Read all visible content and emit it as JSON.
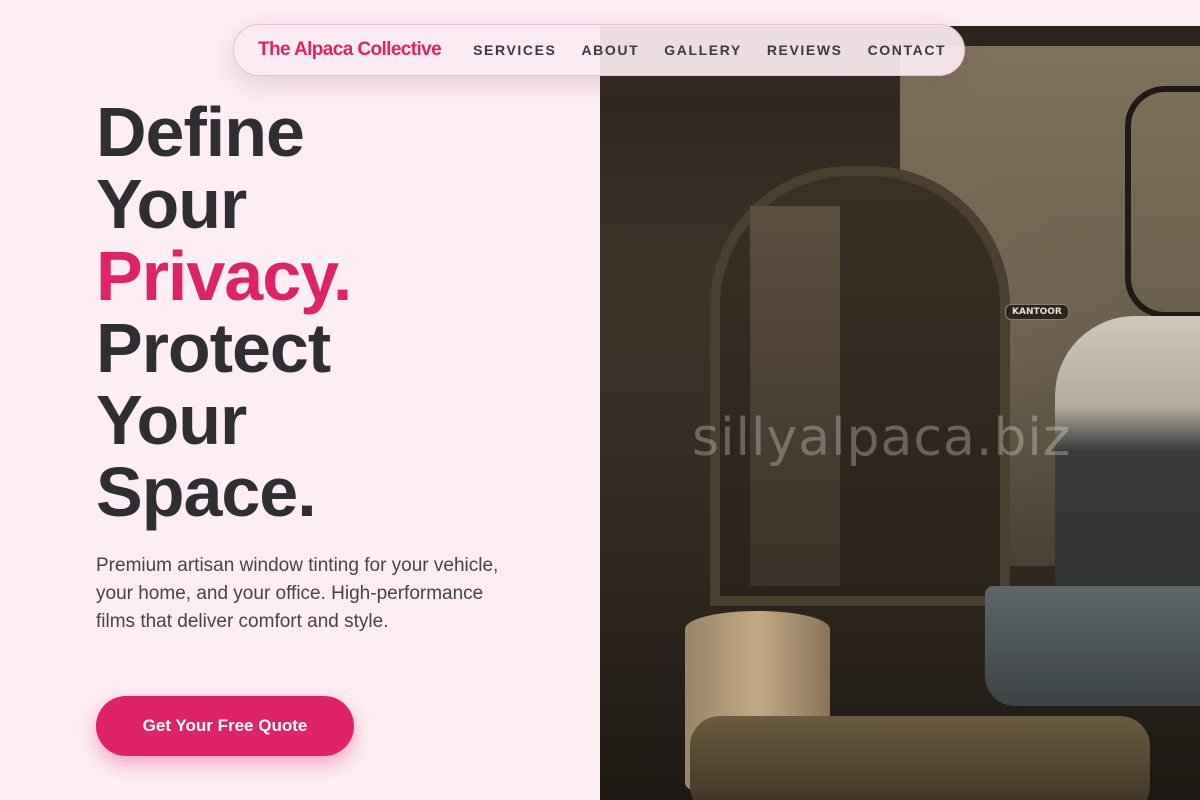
{
  "nav": {
    "brand": "The Alpaca Collective",
    "links": [
      "SERVICES",
      "ABOUT",
      "GALLERY",
      "REVIEWS",
      "CONTACT"
    ]
  },
  "hero": {
    "headline": {
      "line1": "Define",
      "line2": "Your",
      "line3_accent": "Privacy.",
      "line4": "Protect",
      "line5": "Your",
      "line6": "Space."
    },
    "subcopy": "Premium artisan window tinting for your vehicle, your home, and your office. High-performance films that deliver comfort and style.",
    "cta_label": "Get Your Free Quote",
    "image": {
      "watermark": "sillyalpaca.biz",
      "sign_text": "KANTOOR"
    }
  },
  "colors": {
    "accent": "#e02366",
    "background": "#fdeef3",
    "text": "#2f2f33"
  }
}
